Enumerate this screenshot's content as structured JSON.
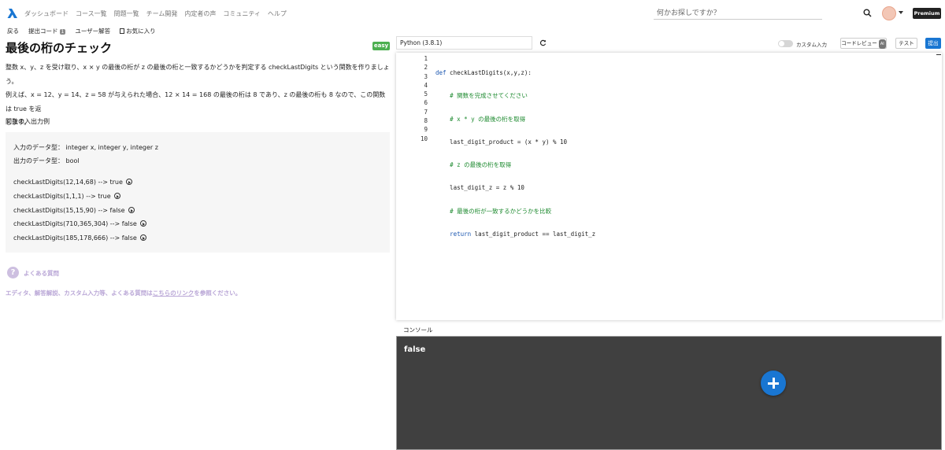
{
  "colors": {
    "accent": "#1976d2",
    "easy_badge": "#4caf50",
    "faq": "#b9a6d6",
    "console_bg": "#404040",
    "keyword": "#1a56b0",
    "comment": "#1d8a2f"
  },
  "header": {
    "nav": [
      "ダッシュボード",
      "コース一覧",
      "問題一覧",
      "チーム開発",
      "内定者の声",
      "コミュニティ",
      "ヘルプ"
    ],
    "search_placeholder": "何かお探しですか？",
    "premium_label": "Premium"
  },
  "subnav": {
    "back": "戻る",
    "submitted_code": "提出コード",
    "submitted_count": "1",
    "user_answers": "ユーザー解答",
    "favorite": "お気に入り"
  },
  "problem": {
    "title": "最後の桁のチェック",
    "difficulty": "easy",
    "description": [
      "整数 x、y、z を受け取り、x × y の最後の桁が z の最後の桁と一致するかどうかを判定する checkLastDigits という関数を作りましょう。",
      "例えば、x = 12、y = 14、z = 58 が与えられた場合、12 × 14 = 168 の最後の桁は 8 であり、z の最後の桁も 8 なので、この関数は true を返",
      "します。"
    ],
    "io_heading": "関数の入出力例",
    "input_type": "入力のデータ型： integer x, integer y, integer z",
    "output_type": "出力のデータ型： bool",
    "examples": [
      "checkLastDigits(12,14,68) --> true",
      "checkLastDigits(1,1,1) --> true",
      "checkLastDigits(15,15,90) --> false",
      "checkLastDigits(710,365,304) --> false",
      "checkLastDigits(185,178,666) --> false"
    ],
    "faq_label": "よくある質問",
    "faq_note_prefix": "エディタ、解答解説、カスタム入力等、よくある質問は",
    "faq_link": "こちらのリンク",
    "faq_note_suffix": "を参照ください。"
  },
  "editor": {
    "language": "Python (3.8.1)",
    "custom_input_label": "カスタム入力",
    "code_review_label": "コードレビュー",
    "code_review_badge": "AI",
    "test_label": "テスト",
    "submit_label": "提出",
    "line_numbers": [
      "1",
      "2",
      "3",
      "4",
      "5",
      "6",
      "7",
      "8",
      "9",
      "10"
    ]
  },
  "console": {
    "label": "コンソール",
    "output": "false"
  }
}
